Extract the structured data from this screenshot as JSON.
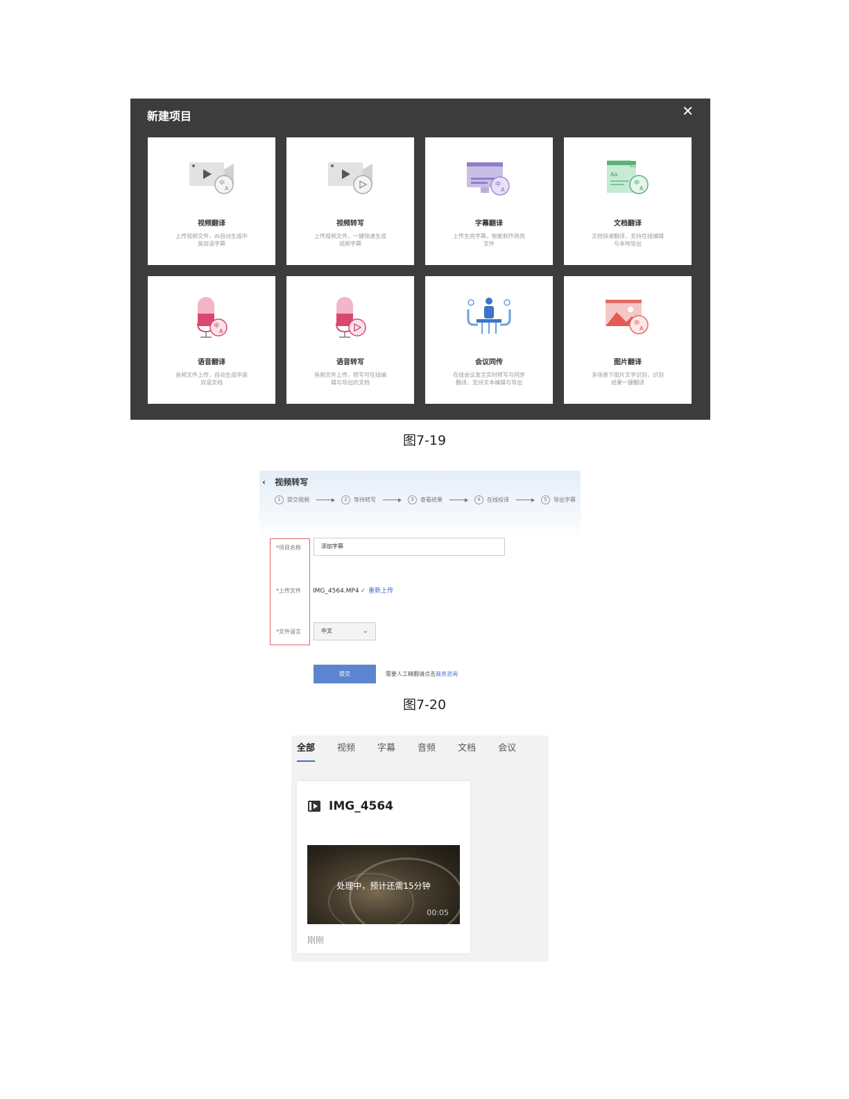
{
  "figure19": {
    "dialog_title": "新建项目",
    "close_glyph": "✕",
    "caption": "图7-19",
    "cards": [
      {
        "name": "视频翻译",
        "desc": "上传视频文件，AI自动生成中英双语字幕",
        "icon": "video-translate-icon"
      },
      {
        "name": "视频转写",
        "desc": "上传视频文件，一键快速生成视频字幕",
        "icon": "video-transcribe-icon"
      },
      {
        "name": "字幕翻译",
        "desc": "上传生肉字幕，智能制作熟肉文件",
        "icon": "subtitle-translate-icon"
      },
      {
        "name": "文档翻译",
        "desc": "文档快速翻译，支持在线编辑与本地导出",
        "icon": "document-translate-icon"
      },
      {
        "name": "语音翻译",
        "desc": "音频文件上传，自动生成中英双语文档",
        "icon": "voice-translate-icon"
      },
      {
        "name": "语音转写",
        "desc": "音频文件上传，转写可在线编辑与导出的文档",
        "icon": "voice-transcribe-icon"
      },
      {
        "name": "会议同传",
        "desc": "在线会议发言实时转写与同步翻译，支持文本编辑与导出",
        "icon": "meeting-interpret-icon"
      },
      {
        "name": "图片翻译",
        "desc": "多场景下图片文字识别，识别结果一键翻译",
        "icon": "image-translate-icon"
      }
    ],
    "colors": {
      "dialog_bg": "#3c3c3c",
      "card_bg": "#ffffff"
    }
  },
  "figure20": {
    "back_title": "视频转写",
    "steps": [
      {
        "num": "1",
        "label": "提交视频"
      },
      {
        "num": "2",
        "label": "等待转写"
      },
      {
        "num": "3",
        "label": "查看结果"
      },
      {
        "num": "4",
        "label": "在线校译"
      },
      {
        "num": "5",
        "label": "导出字幕"
      }
    ],
    "fields": {
      "project_name_label": "*项目名称",
      "project_name_value": "添加字幕",
      "upload_label": "*上传文件",
      "upload_file": "IMG_4564.MP4",
      "upload_check": "✓",
      "reupload": "重新上传",
      "language_label": "*文件语言",
      "language_value": "中文"
    },
    "submit": "提交",
    "hint_text": "需要人工精翻请点击",
    "hint_link": "商务咨询",
    "caption": "图7-20",
    "colors": {
      "accent": "#5b86cf",
      "highlight_box": "#e06060"
    }
  },
  "figure21": {
    "tabs": [
      "全部",
      "视频",
      "字幕",
      "音频",
      "文档",
      "会议"
    ],
    "active_tab": "全部",
    "item": {
      "icon": "video-file-icon",
      "title": "IMG_4564",
      "status": "处理中，预计还需15分钟",
      "duration": "00:05",
      "time": "刚刚"
    }
  }
}
